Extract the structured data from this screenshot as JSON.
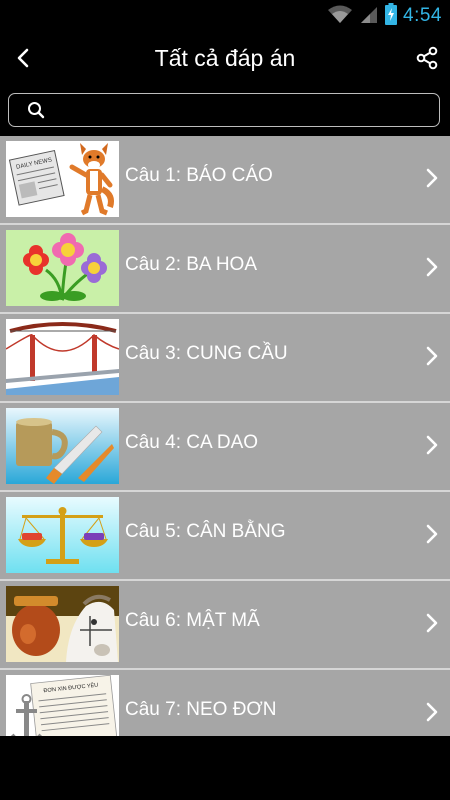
{
  "status": {
    "time": "4:54"
  },
  "header": {
    "title": "Tất cả đáp án"
  },
  "search": {
    "placeholder": "",
    "value": ""
  },
  "list": {
    "items": [
      {
        "label": "Câu 1: BÁO CÁO",
        "thumb": "newspaper-fox"
      },
      {
        "label": "Câu 2: BA HOA",
        "thumb": "three-flowers"
      },
      {
        "label": "Câu 3: CUNG CẦU",
        "thumb": "bow-bridge"
      },
      {
        "label": "Câu 4: CA DAO",
        "thumb": "mug-knife"
      },
      {
        "label": "Câu 5: CÂN BẰNG",
        "thumb": "balance-scale"
      },
      {
        "label": "Câu 6: MẬT MÃ",
        "thumb": "honey-horse"
      },
      {
        "label": "Câu 7: NEO ĐƠN",
        "thumb": "anchor-document"
      }
    ]
  },
  "thumb_texts": {
    "newspaper": "DAILY NEWS",
    "document": "ĐƠN XIN ĐƯỢC YÊU"
  }
}
